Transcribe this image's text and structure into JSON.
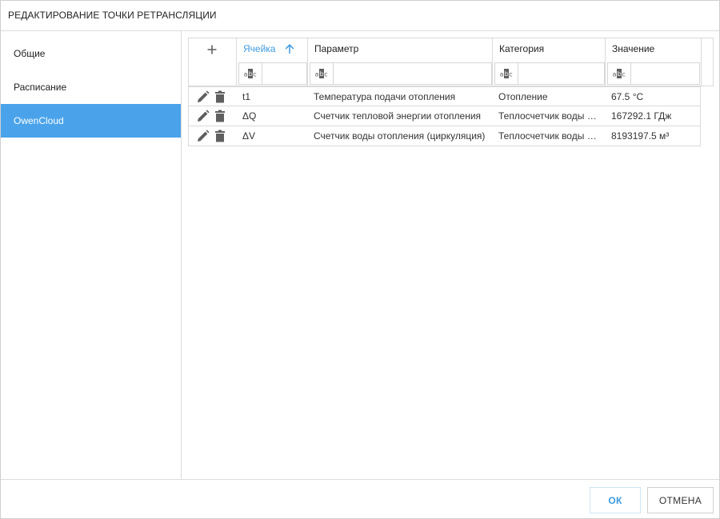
{
  "dialog": {
    "title": "РЕДАКТИРОВАНИЕ ТОЧКИ РЕТРАНСЛЯЦИИ"
  },
  "sidebar": {
    "items": [
      {
        "label": "Общие",
        "active": false
      },
      {
        "label": "Расписание",
        "active": false
      },
      {
        "label": "OwenCloud",
        "active": true
      }
    ]
  },
  "grid": {
    "add_icon": "plus-icon",
    "sort_icon": "arrow-up-icon",
    "filter_icon": "abc-icon",
    "columns": [
      {
        "label": "Ячейка",
        "sorted": "asc"
      },
      {
        "label": "Параметр"
      },
      {
        "label": "Категория"
      },
      {
        "label": "Значение"
      }
    ],
    "filters": {
      "cell": "",
      "param": "",
      "category": "",
      "value": ""
    },
    "rows": [
      {
        "cell": "t1",
        "param": "Температура подачи отопления",
        "category": "Отопление",
        "value": "67.5 °C"
      },
      {
        "cell": "ΔQ",
        "param": "Счетчик тепловой энергии отопления",
        "category": "Теплосчетчик воды отопления",
        "value": "167292.1 ГДж"
      },
      {
        "cell": "ΔV",
        "param": "Счетчик воды отопления (циркуляция)",
        "category": "Теплосчетчик воды отопления",
        "value": "8193197.5 м³"
      }
    ],
    "row_actions": [
      "pencil-icon",
      "trash-icon"
    ]
  },
  "footer": {
    "ok_label": "ОК",
    "cancel_label": "ОТМЕНА"
  },
  "colors": {
    "accent": "#4aa3ea",
    "link": "#3d9ae0",
    "border": "#dadada",
    "icon": "#5f5f5f"
  }
}
